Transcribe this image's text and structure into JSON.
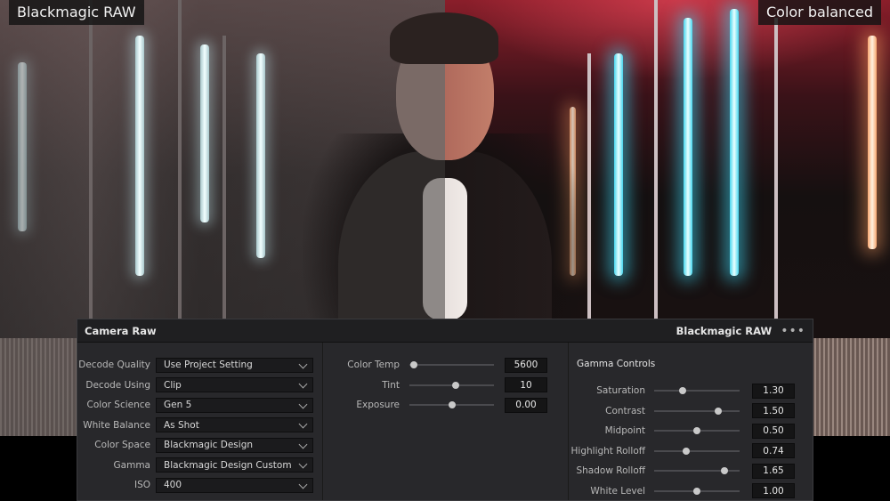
{
  "overlay": {
    "left_label": "Blackmagic RAW",
    "right_label": "Color balanced"
  },
  "panel": {
    "title": "Camera Raw",
    "subtitle": "Blackmagic RAW",
    "more_icon": "more-horizontal-icon",
    "decode": [
      {
        "label": "Decode Quality",
        "value": "Use Project Setting"
      },
      {
        "label": "Decode Using",
        "value": "Clip"
      },
      {
        "label": "Color Science",
        "value": "Gen 5"
      },
      {
        "label": "White Balance",
        "value": "As Shot"
      },
      {
        "label": "Color Space",
        "value": "Blackmagic Design"
      },
      {
        "label": "Gamma",
        "value": "Blackmagic Design Custom"
      },
      {
        "label": "ISO",
        "value": "400"
      }
    ],
    "color": [
      {
        "label": "Color Temp",
        "value": "5600",
        "level": 0.05
      },
      {
        "label": "Tint",
        "value": "10",
        "level": 0.55
      },
      {
        "label": "Exposure",
        "value": "0.00",
        "level": 0.5
      }
    ],
    "gamma_title": "Gamma Controls",
    "gamma": [
      {
        "label": "Saturation",
        "value": "1.30",
        "level": 0.33
      },
      {
        "label": "Contrast",
        "value": "1.50",
        "level": 0.75
      },
      {
        "label": "Midpoint",
        "value": "0.50",
        "level": 0.5
      },
      {
        "label": "Highlight Rolloff",
        "value": "0.74",
        "level": 0.37
      },
      {
        "label": "Shadow Rolloff",
        "value": "1.65",
        "level": 0.82
      },
      {
        "label": "White Level",
        "value": "1.00",
        "level": 0.5
      }
    ]
  }
}
